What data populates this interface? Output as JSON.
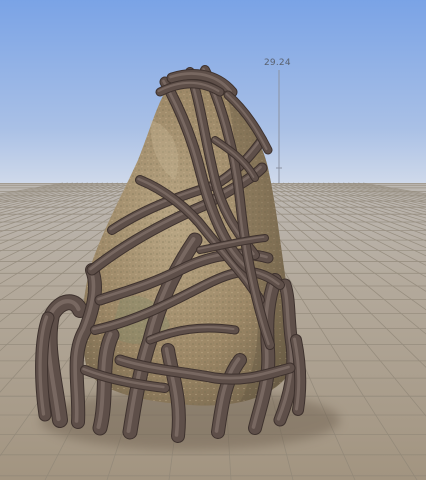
{
  "viewport": {
    "measure_value": "29.24",
    "scene_object": "rock-with-roots-model",
    "colors": {
      "sky_top": "#7fa6e8",
      "sky_horizon": "#c9d6ea",
      "ground_near": "#a89a86",
      "ground_far": "#bdb7b0",
      "grid_line": "#8e8576",
      "rock": "#a08c6e",
      "root": "#5a4a44"
    }
  }
}
